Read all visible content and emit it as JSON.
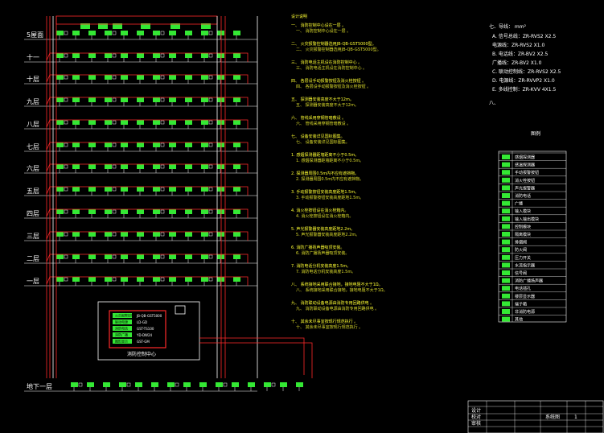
{
  "floors": [
    "5屋面",
    "十一",
    "十层",
    "九层",
    "八层",
    "七层",
    "六层",
    "五层",
    "四层",
    "三层",
    "二层",
    "一层",
    "地下一层"
  ],
  "control_center": {
    "title": "消防控制中心",
    "devices": [
      {
        "name": "火灾报警控制器",
        "model": "JB-QB-GST5000"
      },
      {
        "name": "联动电源",
        "model": "LD-GD"
      },
      {
        "name": "消防电话",
        "model": "GST-TS100"
      },
      {
        "name": "消防广播",
        "model": "YD-DW24"
      },
      {
        "name": "图形显示",
        "model": "GST-GM"
      }
    ]
  },
  "notes": {
    "heading": "设计说明",
    "lines": [
      "一、 消防控制中心设在一层 。",
      "二、 火灾报警控制器选用JB-QB-GST5000型。",
      "三、 消防电话主机设在消防控制中心 。",
      "四、 各层设手动报警按钮及消火栓按钮 。",
      "五、 探测器安装高度不大于12m。",
      "六、 管线采用穿钢管暗敷设 。",
      "七、 设备安装详见国标图集。",
      "1. 感烟探测器距墙距离不小于0.5m。",
      "2. 探测器周围0.5m内不应有遮挡物。",
      "3. 手动报警按钮安装高度距地1.5m。",
      "4. 消火栓按钮设在消火栓箱内。",
      "5. 声光报警器安装高度距地2.2m。",
      "6. 消防广播扬声器吸顶安装。",
      "7. 消防电话分机安装高度1.5m。",
      "八、 系统接地采用联合接地，接地电阻不大于1Ω。",
      "九、 消防联动设备电源由消防专用回路供电 。",
      "十、 其余未尽事宜按现行规范执行 。"
    ]
  },
  "wire_spec": {
    "heading": "七、导线： mm²",
    "items": [
      "A. 信号总线：ZR-RVS2 X2.5",
      "   电源线：ZR-RVS2 X1.0",
      "B. 电话线：ZR-BV2 X2.5",
      "   广播线：ZR-BV2 X1.0",
      "C. 联动控制线：ZR-RVS2 X2.5",
      "D. 电源线：ZR-RVVP2 X1.0",
      "E. 多线控制：ZR-KVV 4X1.5"
    ]
  },
  "legend_title": "图例",
  "legend_items": [
    "感烟探测器",
    "感温探测器",
    "手动报警按钮",
    "消火栓按钮",
    "声光报警器",
    "消防电话",
    "广播",
    "输入模块",
    "输入输出模块",
    "控制模块",
    "隔离模块",
    "排烟阀",
    "防火阀",
    "压力开关",
    "水流指示器",
    "信号阀",
    "消防广播扬声器",
    "电话插孔",
    "楼层显示器",
    "端子箱",
    "非消防电源",
    "其他"
  ],
  "title_block": {
    "label_1": "设计",
    "label_2": "校对",
    "label_3": "审核",
    "drawing_name": "系统图",
    "sheet": "1"
  },
  "colors": {
    "red": "#ff2a2a",
    "green": "#34e834",
    "yellow": "#ffff33",
    "white": "#ffffff",
    "cyan": "#4ce0ff"
  }
}
